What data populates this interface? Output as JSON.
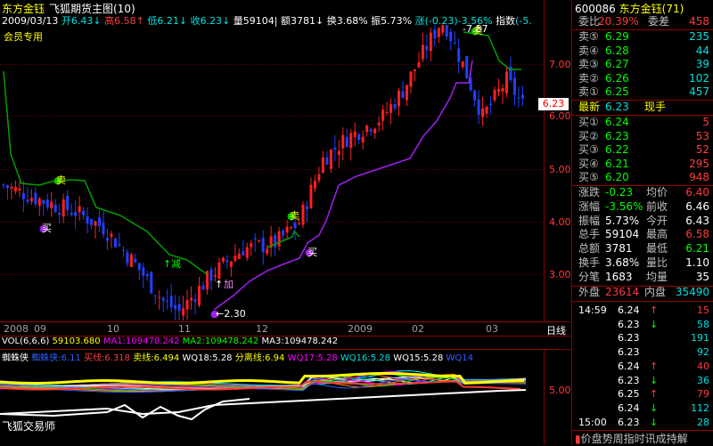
{
  "header": {
    "stock_name": "东方金钰",
    "chart_title": "飞狐期货主图(10)",
    "member_label": "会员专用",
    "date": "2009/03/13",
    "open_label": "开",
    "open": "6.43",
    "high_label": "高",
    "high": "6.58",
    "low_label": "低",
    "low": "6.21",
    "close_label": "收",
    "close": "6.23",
    "vol_label": "量",
    "vol": "59104",
    "amt_label": "额",
    "amt": "3781",
    "turn_label": "换",
    "turn": "3.68%",
    "amp_label": "振",
    "amp": "5.73%",
    "chg_label": "涨",
    "chg": "(-0.23)-3.56%",
    "idx_label": "指数",
    "idx": "(-5."
  },
  "price_axis": {
    "labels": [
      "7.00",
      "6.00",
      "5.00",
      "4.00",
      "3.00"
    ],
    "current": "6.23"
  },
  "date_axis": {
    "labels": [
      "2008",
      "09",
      "10",
      "11",
      "12",
      "2009",
      "02",
      "03"
    ],
    "period": "日线"
  },
  "chart_marks": {
    "high_mark": "7.87",
    "low_mark": "2.30",
    "sell": "卖",
    "buy": "买",
    "reduce": "减",
    "add": "加"
  },
  "volume_line": {
    "prefix": "VOL(6,6,6)",
    "vol": "59103.680",
    "ma1_label": "MA1:",
    "ma1": "109478.242",
    "ma2_label": "MA2:",
    "ma2": "109478.242",
    "ma3_label": "MA3:",
    "ma3": "109478.242"
  },
  "indicator": {
    "name": "蜘蛛侠",
    "sub_name": "蜘蛛侠:",
    "sub_value": "6.11",
    "buy_label": "买线:",
    "buy_value": "6.318",
    "sell_label": "卖线:",
    "sell_value": "6.494",
    "wq18": "WQ18:5.28",
    "div_label": "分离线:",
    "div_value": "6.94",
    "wq17": "WQ17:5.28",
    "wq16": "WQ16:5.28",
    "wq15": "WQ15:5.28",
    "wq14": "WQ14",
    "axis_label": "5.00"
  },
  "footer": {
    "app_name": "飞狐交易师"
  },
  "quote": {
    "code": "600086",
    "name": "东方金钰",
    "badge": "(71)",
    "ratio_label": "委比",
    "ratio": "20.39%",
    "diff_label": "委差",
    "diff": "458",
    "asks": [
      {
        "label": "卖⑤",
        "price": "6.29",
        "vol": "235"
      },
      {
        "label": "卖④",
        "price": "6.28",
        "vol": "44"
      },
      {
        "label": "卖③",
        "price": "6.27",
        "vol": "39"
      },
      {
        "label": "卖②",
        "price": "6.26",
        "vol": "102"
      },
      {
        "label": "卖①",
        "price": "6.25",
        "vol": "457"
      }
    ],
    "last_label": "最新",
    "last": "6.23",
    "last_vol_label": "现手",
    "bids": [
      {
        "label": "买①",
        "price": "6.24",
        "vol": "5"
      },
      {
        "label": "买②",
        "price": "6.23",
        "vol": "53"
      },
      {
        "label": "买③",
        "price": "6.22",
        "vol": "52"
      },
      {
        "label": "买④",
        "price": "6.21",
        "vol": "295"
      },
      {
        "label": "买⑤",
        "price": "6.20",
        "vol": "948"
      }
    ],
    "stats": [
      {
        "l1": "涨跌",
        "v1": "-0.23",
        "l2": "均价",
        "v2": "6.40"
      },
      {
        "l1": "涨幅",
        "v1": "-3.56%",
        "l2": "前收",
        "v2": "6.46"
      },
      {
        "l1": "振幅",
        "v1": "5.73%",
        "l2": "今开",
        "v2": "6.43"
      },
      {
        "l1": "总手",
        "v1": "59104",
        "l2": "最高",
        "v2": "6.58"
      },
      {
        "l1": "总额",
        "v1": "3781",
        "l2": "最低",
        "v2": "6.21"
      },
      {
        "l1": "换手",
        "v1": "3.68%",
        "l2": "量比",
        "v2": "1.10"
      },
      {
        "l1": "分笔",
        "v1": "1683",
        "l2": "均量",
        "v2": "35"
      }
    ],
    "outer_label": "外盘",
    "outer": "23614",
    "inner_label": "内盘",
    "inner": "35490",
    "ticks": [
      {
        "time": "14:59",
        "price": "6.24",
        "dir": "↑",
        "vol": "15"
      },
      {
        "time": "",
        "price": "6.23",
        "dir": "↓",
        "vol": "58"
      },
      {
        "time": "",
        "price": "6.23",
        "dir": "",
        "vol": "191"
      },
      {
        "time": "",
        "price": "6.23",
        "dir": "",
        "vol": "92"
      },
      {
        "time": "",
        "price": "6.24",
        "dir": "↑",
        "vol": "40"
      },
      {
        "time": "",
        "price": "6.23",
        "dir": "↓",
        "vol": "36"
      },
      {
        "time": "",
        "price": "6.25",
        "dir": "↑",
        "vol": "79"
      },
      {
        "time": "",
        "price": "6.24",
        "dir": "↓",
        "vol": "112"
      },
      {
        "time": "15:00",
        "price": "6.23",
        "dir": "↓",
        "vol": "28"
      }
    ],
    "bottom_text": "价盘势周指时讯成持解"
  },
  "chart_data": {
    "type": "candlestick",
    "price_range": [
      2.3,
      7.87
    ],
    "current_price": 6.23,
    "up_color": "#ff2020",
    "down_color": "#2040ff",
    "support_color": "#00a000",
    "trail_color": "#a020f0",
    "segments_note": "approximate path of daily closes, Aug 2008 – Mar 2009",
    "path": [
      [
        0,
        4.7
      ],
      [
        10,
        4.4
      ],
      [
        18,
        4.2
      ],
      [
        25,
        3.9
      ],
      [
        33,
        3.2
      ],
      [
        40,
        2.5
      ],
      [
        44,
        2.3
      ],
      [
        52,
        3.0
      ],
      [
        60,
        3.5
      ],
      [
        68,
        3.6
      ],
      [
        74,
        4.0
      ],
      [
        80,
        5.2
      ],
      [
        86,
        5.6
      ],
      [
        95,
        6.0
      ],
      [
        100,
        6.5
      ],
      [
        105,
        7.2
      ],
      [
        110,
        7.87
      ],
      [
        115,
        7.0
      ],
      [
        120,
        6.0
      ],
      [
        126,
        6.7
      ],
      [
        130,
        6.23
      ]
    ]
  }
}
